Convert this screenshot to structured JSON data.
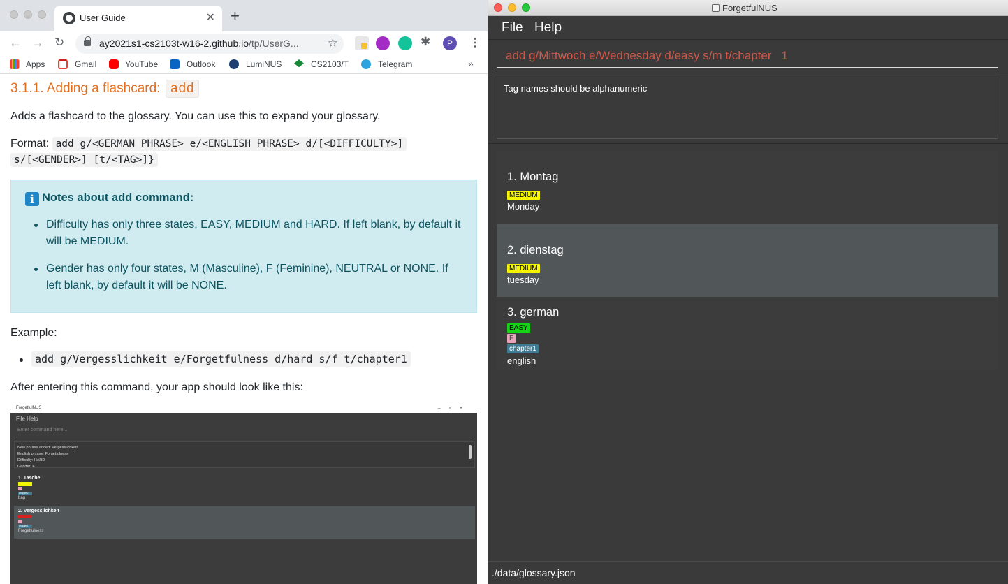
{
  "browser": {
    "tab_title": "User Guide",
    "url_host": "ay2021s1-cs2103t-w16-2.github.io",
    "url_path": "/tp/UserG...",
    "bookmarks": [
      "Apps",
      "Gmail",
      "YouTube",
      "Outlook",
      "LumiNUS",
      "CS2103/T",
      "Telegram"
    ],
    "bookmarks_more": "»",
    "profile_initial": "P"
  },
  "guide": {
    "heading_number": "3.1.1. Adding a flashcard:",
    "heading_code": "add",
    "intro": "Adds a flashcard to the glossary. You can use this to expand your glossary.",
    "format_label": "Format:",
    "format_code_line1": "add g/<GERMAN PHRASE> e/<ENGLISH PHRASE> d/[<DIFFICULTY>]",
    "format_code_line2": "s/[<GENDER>] [t/<TAG>]}",
    "notes_title": "Notes about add command:",
    "notes": [
      "Difficulty has only three states, EASY, MEDIUM and HARD. If left blank, by default it will be MEDIUM.",
      "Gender has only four states, M (Masculine), F (Feminine), NEUTRAL or NONE. If left blank, by default it will be NONE."
    ],
    "example_label": "Example:",
    "example_code": "add g/Vergesslichkeit e/Forgetfulness d/hard s/f t/chapter1",
    "after_text": "After entering this command, your app should look like this:"
  },
  "mini_screenshot": {
    "title": "ForgetfulNUS",
    "menu": "File   Help",
    "placeholder": "Enter command here...",
    "result_lines": [
      "New phrase added: Vergesslichkeit",
      "English phrase: Forgetfulness",
      "Difficulty: HARD",
      "Gender: F"
    ],
    "cards": [
      {
        "name": "1.  Tasche",
        "tag": "chapter2",
        "english": "bag"
      },
      {
        "name": "2.  Vergesslichkeit",
        "tag": "chapter1",
        "english": "Forgetfulness"
      }
    ]
  },
  "app": {
    "title": "ForgetfulNUS",
    "menu": {
      "file": "File",
      "help": "Help"
    },
    "command_value": "add g/Mittwoch e/Wednesday d/easy s/m t/chapter   1",
    "result_text": "Tag names should be alphanumeric",
    "cards": [
      {
        "name": "1.  Montag",
        "difficulty": "MEDIUM",
        "english": "Monday"
      },
      {
        "name": "2.  dienstag",
        "difficulty": "MEDIUM",
        "english": "tuesday"
      },
      {
        "name": "3.  german",
        "difficulty": "EASY",
        "gender": "F",
        "tag": "chapter1",
        "english": "english"
      }
    ],
    "status_path": "./data/glossary.json",
    "colors": {
      "command_text": "#d0584a",
      "medium": "#f5f500",
      "easy": "#15d415",
      "gender_f": "#e8a6bd",
      "tag": "#3e7b91",
      "hard": "#d91f1f"
    }
  }
}
